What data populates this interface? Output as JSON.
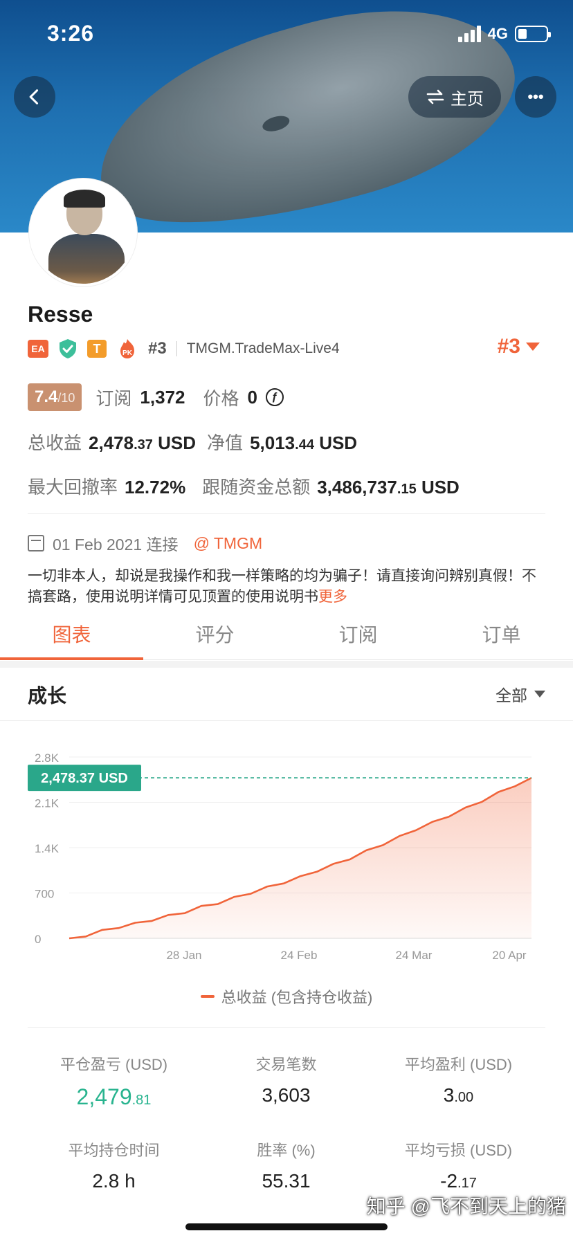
{
  "status_bar": {
    "time": "3:26",
    "network": "4G"
  },
  "header": {
    "home_label": "主页",
    "more_label": "•••"
  },
  "profile": {
    "name": "Resse",
    "badges": {
      "ea": "EA",
      "t": "T",
      "pk": "PK"
    },
    "rank_small": "#3",
    "server": "TMGM.TradeMax-Live4",
    "rank_big": "#3"
  },
  "metrics": {
    "score": "7.4",
    "score_max": "/10",
    "subscribe_label": "订阅",
    "subscribe_value": "1,372",
    "price_label": "价格",
    "price_value": "0",
    "coin_symbol": "ƒ",
    "total_profit_label": "总收益",
    "total_profit_main": "2,478",
    "total_profit_dec": ".37",
    "total_profit_unit": "USD",
    "equity_label": "净值",
    "equity_main": "5,013",
    "equity_dec": ".44",
    "equity_unit": "USD",
    "max_drawdown_label": "最大回撤率",
    "max_drawdown_value": "12.72%",
    "follow_funds_label": "跟随资金总额",
    "follow_funds_main": "3,486,737",
    "follow_funds_dec": ".15",
    "follow_funds_unit": "USD"
  },
  "connect": {
    "date": "01 Feb 2021 连接",
    "broker": "@ TMGM"
  },
  "description": {
    "text": "一切非本人，却说是我操作和我一样策略的均为骗子！请直接询问辨别真假！不搞套路，使用说明详情可见顶置的使用说明书",
    "more": "更多"
  },
  "tabs": [
    {
      "label": "图表",
      "active": true
    },
    {
      "label": "评分",
      "active": false
    },
    {
      "label": "订阅",
      "active": false
    },
    {
      "label": "订单",
      "active": false
    }
  ],
  "growth": {
    "title": "成长",
    "filter": "全部"
  },
  "chart_data": {
    "type": "area",
    "y_ticks": [
      "0",
      "700",
      "1.4K",
      "2.1K",
      "2.8K"
    ],
    "x_ticks": [
      "28 Jan",
      "24 Feb",
      "24 Mar",
      "20 Apr"
    ],
    "ylim": [
      0,
      2800
    ],
    "current_label": "2,478.37 USD",
    "current_value": 2478.37,
    "series": [
      {
        "name": "总收益 (包含持仓收益)",
        "color": "#f0643a",
        "values": [
          0,
          60,
          130,
          190,
          240,
          300,
          360,
          420,
          500,
          560,
          640,
          720,
          800,
          880,
          960,
          1060,
          1150,
          1250,
          1360,
          1470,
          1580,
          1700,
          1800,
          1910,
          2020,
          2140,
          2260,
          2380,
          2478.37
        ]
      }
    ]
  },
  "legend": {
    "label": "总收益 (包含持仓收益)"
  },
  "stats": [
    {
      "label": "平仓盈亏 (USD)",
      "main": "2,479",
      "dec": ".81",
      "green": true
    },
    {
      "label": "交易笔数",
      "main": "3,603",
      "dec": "",
      "green": false
    },
    {
      "label": "平均盈利 (USD)",
      "main": "3",
      "dec": ".00",
      "green": false
    },
    {
      "label": "平均持仓时间",
      "main": "2.8 h",
      "dec": "",
      "green": false
    },
    {
      "label": "胜率 (%)",
      "main": "55.31",
      "dec": "",
      "green": false
    },
    {
      "label": "平均亏损 (USD)",
      "main": "-2",
      "dec": ".17",
      "green": false
    }
  ],
  "watermark": "知乎 @飞不到天上的猪"
}
